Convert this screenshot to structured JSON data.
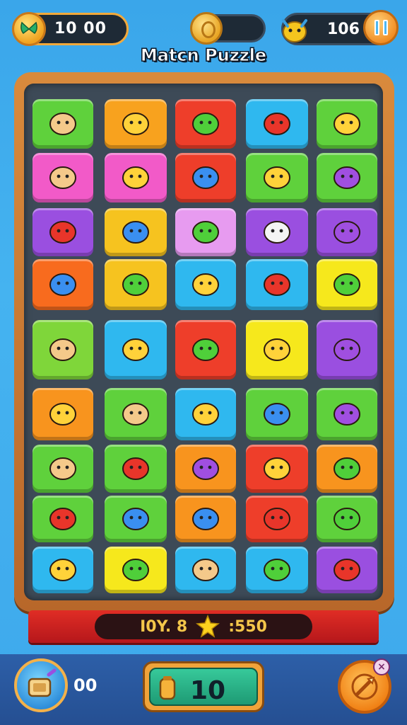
{
  "hud": {
    "timer_value": "10 00",
    "coins_value": "",
    "pet_count": "106"
  },
  "title": "Matcn Puzzle",
  "board": {
    "tiles": [
      {
        "row": 0,
        "col": 0,
        "color": "#5fd13c",
        "icon": "boy-face-icon"
      },
      {
        "row": 0,
        "col": 1,
        "color": "#f8a21e",
        "icon": "leaf-icon"
      },
      {
        "row": 0,
        "col": 2,
        "color": "#ee3e2a",
        "icon": "green-creature-icon"
      },
      {
        "row": 0,
        "col": 3,
        "color": "#2fb8ef",
        "icon": "red-creature-icon"
      },
      {
        "row": 0,
        "col": 4,
        "color": "#5fd13c",
        "icon": "yellow-creature-icon"
      },
      {
        "row": 1,
        "col": 0,
        "color": "#f25ac8",
        "icon": "boy-face-icon"
      },
      {
        "row": 1,
        "col": 1,
        "color": "#f25ac8",
        "icon": "alarm-clock-icon"
      },
      {
        "row": 1,
        "col": 2,
        "color": "#ee3e2a",
        "icon": "blue-drop-icon"
      },
      {
        "row": 1,
        "col": 3,
        "color": "#5fd13c",
        "icon": "yellow-lion-icon"
      },
      {
        "row": 1,
        "col": 4,
        "color": "#5fd13c",
        "icon": "pink-roller-icon"
      },
      {
        "row": 2,
        "col": 0,
        "color": "#9a4fe0",
        "icon": "red-scroll-icon"
      },
      {
        "row": 2,
        "col": 1,
        "color": "#f6c31f",
        "icon": "blue-blob-icon"
      },
      {
        "row": 2,
        "col": 2,
        "color": "#e79bf0",
        "icon": "green-leaf-icon"
      },
      {
        "row": 2,
        "col": 3,
        "color": "#9a4fe0",
        "icon": "white-mouse-icon"
      },
      {
        "row": 2,
        "col": 4,
        "color": "#9a4fe0",
        "icon": "pink-pencil-icon"
      },
      {
        "row": 3,
        "col": 0,
        "color": "#f86b1e",
        "icon": "blue-box-icon"
      },
      {
        "row": 3,
        "col": 1,
        "color": "#f6c31f",
        "icon": "green-bottle-icon"
      },
      {
        "row": 3,
        "col": 2,
        "color": "#2fb8ef",
        "icon": "yellow-coin-icon"
      },
      {
        "row": 3,
        "col": 3,
        "color": "#2fb8ef",
        "icon": "red-orb-icon"
      },
      {
        "row": 3,
        "col": 4,
        "color": "#f6e81c",
        "icon": "green-block-icon"
      },
      {
        "row": 4,
        "col": 0,
        "color": "#7fd63a",
        "icon": "yellow-chick-icon"
      },
      {
        "row": 4,
        "col": 1,
        "color": "#2fb8ef",
        "icon": "orange-bug-icon"
      },
      {
        "row": 4,
        "col": 2,
        "color": "#ee3e2a",
        "icon": "green-bubble-icon"
      },
      {
        "row": 4,
        "col": 3,
        "color": "#f6e81c",
        "icon": "magic-mirror-icon"
      },
      {
        "row": 4,
        "col": 4,
        "color": "#9a4fe0",
        "icon": "purple-ring-icon"
      },
      {
        "row": 5,
        "col": 0,
        "color": "#f8941e",
        "icon": "yellow-bottle-icon"
      },
      {
        "row": 5,
        "col": 1,
        "color": "#5fd13c",
        "icon": "boy-face-icon"
      },
      {
        "row": 5,
        "col": 2,
        "color": "#2fb8ef",
        "icon": "yellow-lemon-icon"
      },
      {
        "row": 5,
        "col": 3,
        "color": "#5fd13c",
        "icon": "blue-gift-icon"
      },
      {
        "row": 5,
        "col": 4,
        "color": "#5fd13c",
        "icon": "purple-bottle-icon"
      },
      {
        "row": 6,
        "col": 0,
        "color": "#5fd13c",
        "icon": "yellow-cat-icon"
      },
      {
        "row": 6,
        "col": 1,
        "color": "#5fd13c",
        "icon": "red-apple-icon"
      },
      {
        "row": 6,
        "col": 2,
        "color": "#f8941e",
        "icon": "purple-eggplant-icon"
      },
      {
        "row": 6,
        "col": 3,
        "color": "#ee3e2a",
        "icon": "wand-icon"
      },
      {
        "row": 6,
        "col": 4,
        "color": "#f8941e",
        "icon": "green-turtle-icon"
      },
      {
        "row": 7,
        "col": 0,
        "color": "#5fd13c",
        "icon": "red-berry-icon"
      },
      {
        "row": 7,
        "col": 1,
        "color": "#5fd13c",
        "icon": "butterfly-icon"
      },
      {
        "row": 7,
        "col": 2,
        "color": "#f8941e",
        "icon": "blue-package-icon"
      },
      {
        "row": 7,
        "col": 3,
        "color": "#ee3e2a",
        "icon": "red-cracker-icon"
      },
      {
        "row": 7,
        "col": 4,
        "color": "#5fd13c",
        "icon": "green-key-icon"
      },
      {
        "row": 8,
        "col": 0,
        "color": "#2fb8ef",
        "icon": "yellow-ball-icon"
      },
      {
        "row": 8,
        "col": 1,
        "color": "#f6e81c",
        "icon": "green-frog-icon"
      },
      {
        "row": 8,
        "col": 2,
        "color": "#2fb8ef",
        "icon": "tan-puppy-icon"
      },
      {
        "row": 8,
        "col": 3,
        "color": "#2fb8ef",
        "icon": "green-dino-icon"
      },
      {
        "row": 8,
        "col": 4,
        "color": "#9a4fe0",
        "icon": "red-octopus-icon"
      }
    ]
  },
  "score_bar": {
    "left_text": "I0Y. 8",
    "right_text": ":550"
  },
  "bottom": {
    "booster_count": "00",
    "moves_value": "10",
    "close_label": "×"
  }
}
